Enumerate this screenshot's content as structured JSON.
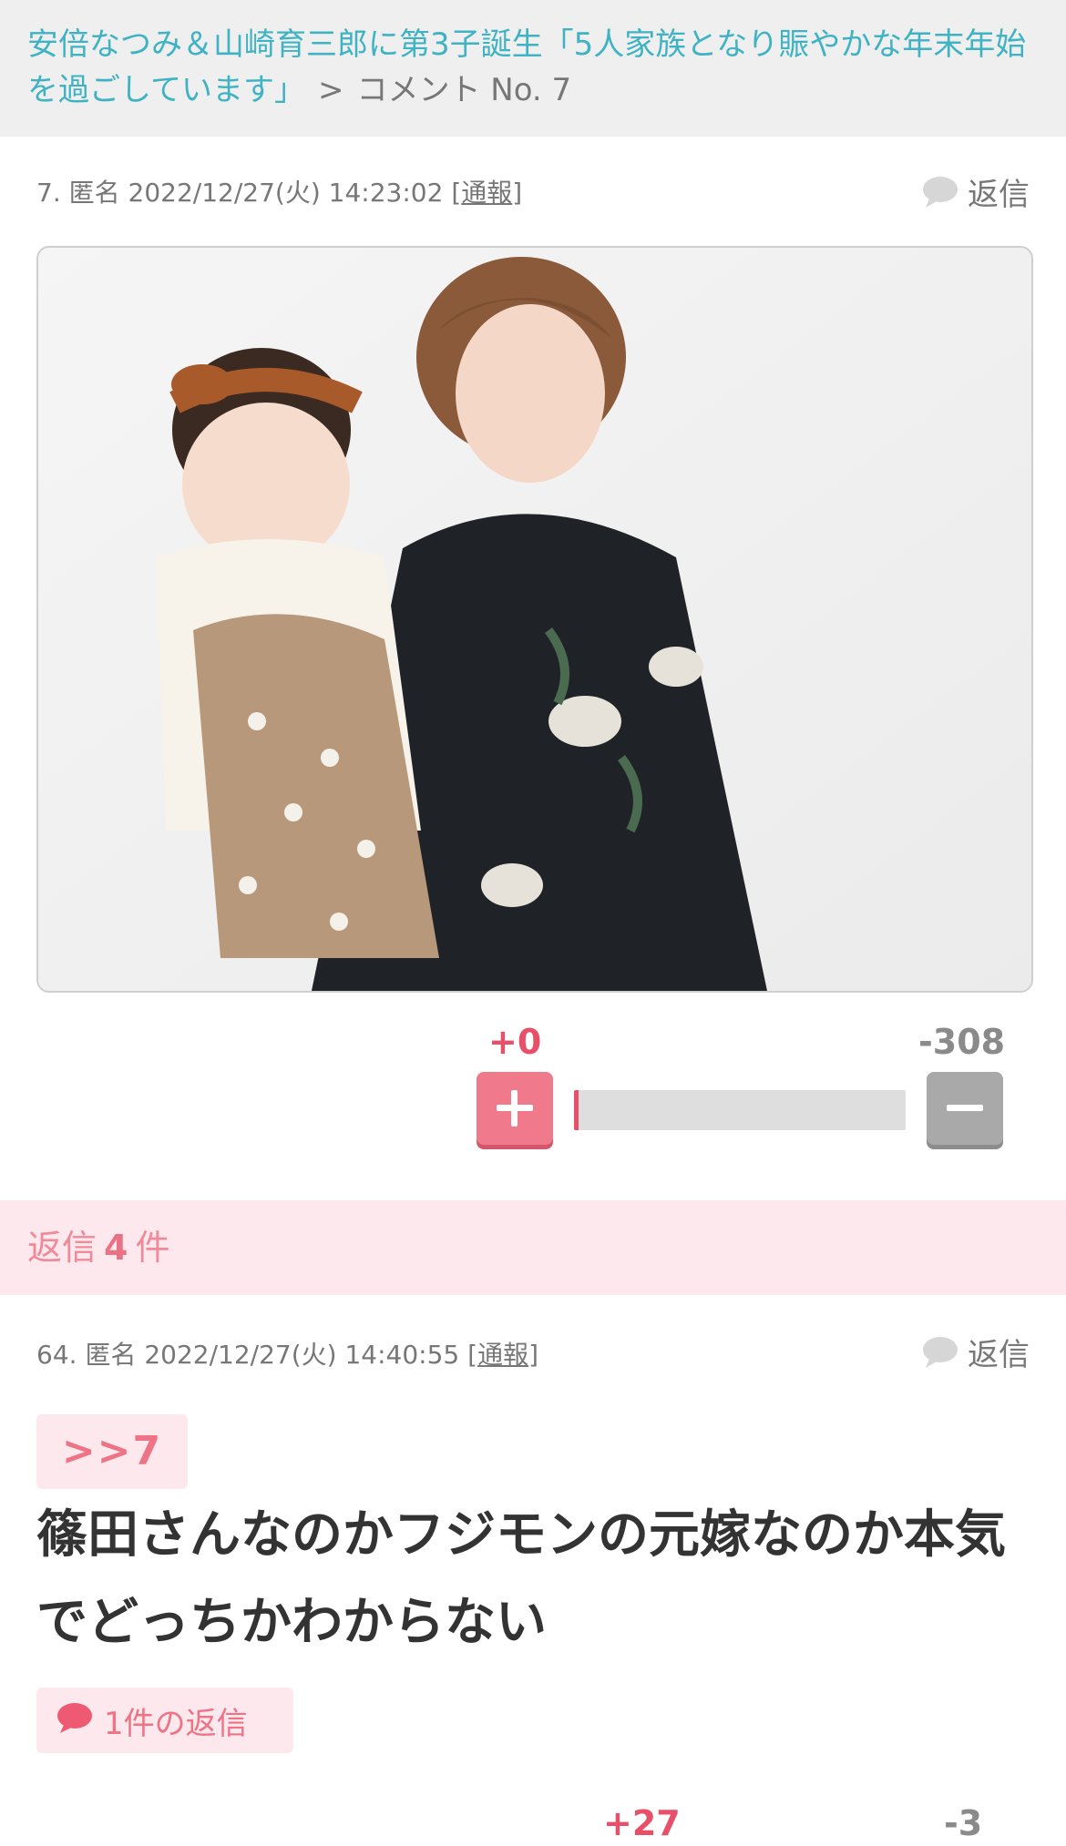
{
  "breadcrumb": {
    "topic_title": "安倍なつみ＆山崎育三郎に第3子誕生「5人家族となり賑やかな年末年始を過ごしています」",
    "separator": ">",
    "current": "コメント No. 7"
  },
  "comment": {
    "number": "7.",
    "author": "匿名",
    "datetime": "2022/12/27(火) 14:23:02",
    "report_open": "[",
    "report_label": "通報",
    "report_close": "]",
    "reply_label": "返信",
    "photo_icon": "photo-of-woman-and-baby",
    "plus_count": "+0",
    "minus_count": "-308",
    "plus_ratio": 0
  },
  "replies_header": {
    "prefix": "返信",
    "count": "4",
    "suffix": "件"
  },
  "reply": {
    "number": "64.",
    "author": "匿名",
    "datetime": "2022/12/27(火) 14:40:55",
    "report_open": "[",
    "report_label": "通報",
    "report_close": "]",
    "reply_label": "返信",
    "anchor": ">>7",
    "body": "篠田さんなのかフジモンの元嫁なのか本気でどっちかわからない",
    "reply_count_label": "1件の返信",
    "plus_count": "+27",
    "minus_count": "-3"
  },
  "colors": {
    "accent_pink": "#e8506a",
    "link_teal": "#3fb3c3",
    "pink_bg": "#fde9ed"
  }
}
